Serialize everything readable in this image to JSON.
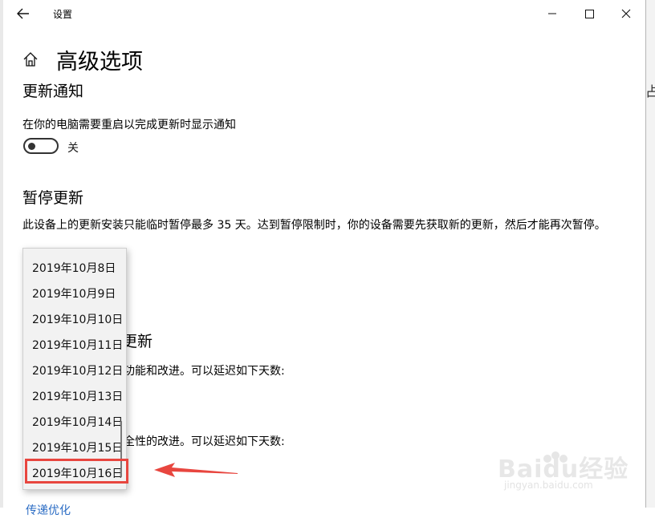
{
  "window": {
    "title": "设置"
  },
  "page": {
    "title": "高级选项"
  },
  "background_right_char": "占",
  "update_notify": {
    "heading": "更新通知",
    "description": "在你的电脑需要重启以完成更新时显示通知",
    "toggle_state": "关",
    "toggle_on": false
  },
  "pause": {
    "heading": "暂停更新",
    "description": "此设备上的更新安装只能临时暂停最多 35 天。达到暂停限制时，你的设备需要先获取新的更新，然后才能再次暂停。"
  },
  "partially_hidden": {
    "heading_fragment": "更新",
    "line1_fragment": "功能和改进。可以延迟如下天数:",
    "line2_fragment": "全性的改进。可以延迟如下天数:",
    "link_fragment": "传递优化"
  },
  "dropdown": {
    "options": [
      "2019年10月8日",
      "2019年10月9日",
      "2019年10月10日",
      "2019年10月11日",
      "2019年10月12日",
      "2019年10月13日",
      "2019年10月14日",
      "2019年10月15日",
      "2019年10月16日"
    ],
    "selected_index": 8
  },
  "watermark": {
    "text": "Baidu经验",
    "sub": "jingyan.baidu.com"
  },
  "colors": {
    "accent": "#2b6cc4",
    "annotation": "#e8463f"
  }
}
